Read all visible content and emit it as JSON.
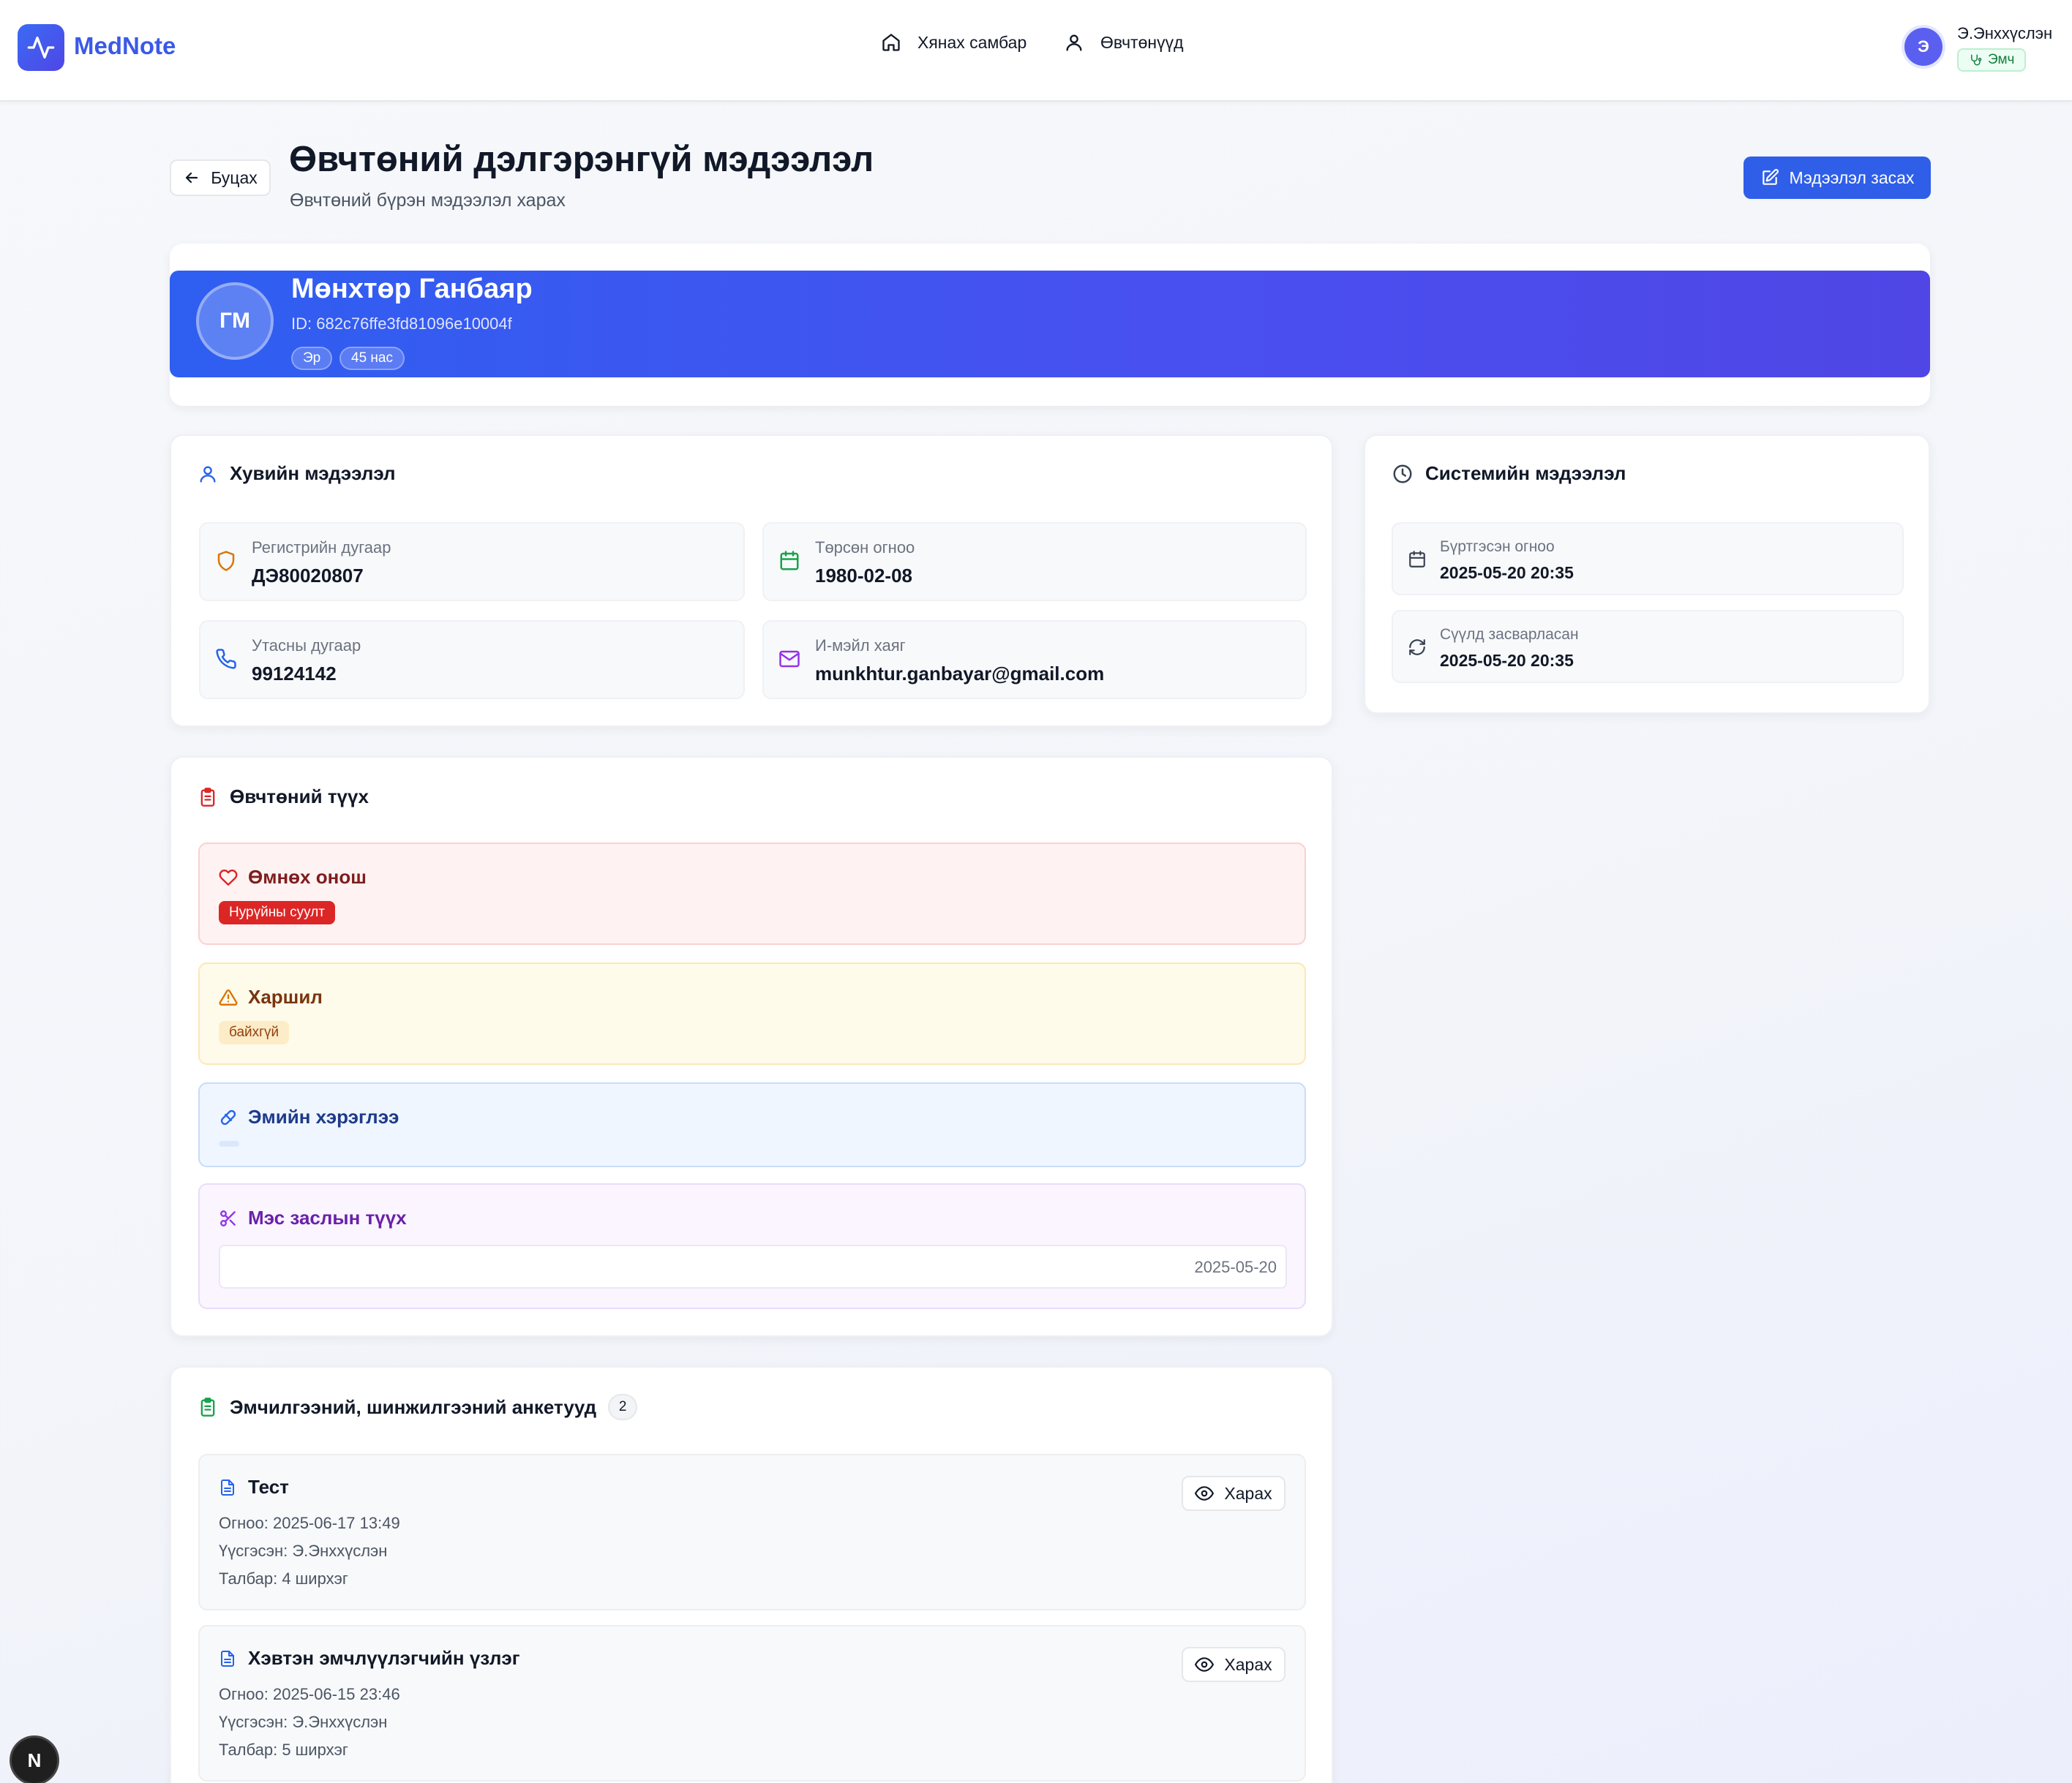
{
  "header": {
    "app_name": "MedNote",
    "nav": [
      {
        "label": "Хянах самбар",
        "icon": "home-icon"
      },
      {
        "label": "Өвчтөнүүд",
        "icon": "user-icon"
      }
    ],
    "user": {
      "initial": "Э",
      "name": "Э.Энххүслэн",
      "role": "Эмч"
    }
  },
  "page": {
    "back_label": "Буцах",
    "title": "Өвчтөний дэлгэрэнгүй мэдээлэл",
    "subtitle": "Өвчтөний бүрэн мэдээлэл харах",
    "edit_label": "Мэдээлэл засах"
  },
  "patient": {
    "initials": "ГМ",
    "name": "Мөнхтөр Ганбаяр",
    "id_text": "ID: 682c76ffe3fd81096e10004f",
    "gender": "Эр",
    "age": "45 нас"
  },
  "personal": {
    "title": "Хувийн мэдээлэл",
    "fields": [
      {
        "label": "Регистрийн дугаар",
        "value": "ДЭ80020807",
        "icon": "shield-icon",
        "color": "#d97706"
      },
      {
        "label": "Төрсөн огноо",
        "value": "1980-02-08",
        "icon": "calendar-icon",
        "color": "#16a34a"
      },
      {
        "label": "Утасны дугаар",
        "value": "99124142",
        "icon": "phone-icon",
        "color": "#2563eb"
      },
      {
        "label": "И-мэйл хаяг",
        "value": "munkhtur.ganbayar@gmail.com",
        "icon": "mail-icon",
        "color": "#9333ea"
      }
    ]
  },
  "system": {
    "title": "Системийн мэдээлэл",
    "fields": [
      {
        "label": "Бүртгэсэн огноо",
        "value": "2025-05-20 20:35",
        "icon": "calendar-icon"
      },
      {
        "label": "Сүүлд засварласан",
        "value": "2025-05-20 20:35",
        "icon": "refresh-icon"
      }
    ]
  },
  "history": {
    "title": "Өвчтөний түүх",
    "diagnosis": {
      "title": "Өмнөх онош",
      "tag": "Нурүйны суулт",
      "color": "#dc2626"
    },
    "allergy": {
      "title": "Харшил",
      "tag": "байхгүй",
      "color": "#b45309"
    },
    "medication": {
      "title": "Эмийн хэрэглээ",
      "color": "#1e3a8a"
    },
    "surgery": {
      "title": "Мэс заслын түүх",
      "date": "2025-05-20",
      "color": "#6b21a8"
    }
  },
  "forms": {
    "title": "Эмчилгээний, шинжилгээний анкетууд",
    "count": "2",
    "view_label": "Харах",
    "items": [
      {
        "title": "Тест",
        "date": "Огноо: 2025-06-17 13:49",
        "author": "Үүсгэсэн: Э.Энххүслэн",
        "fields": "Талбар: 4 ширхэг"
      },
      {
        "title": "Хэвтэн эмчлүүлэгчийн үзлэг",
        "date": "Огноо: 2025-06-15 23:46",
        "author": "Үүсгэсэн: Э.Энххүслэн",
        "fields": "Талбар: 5 ширхэг"
      }
    ]
  },
  "devtools": {
    "label": "N"
  }
}
